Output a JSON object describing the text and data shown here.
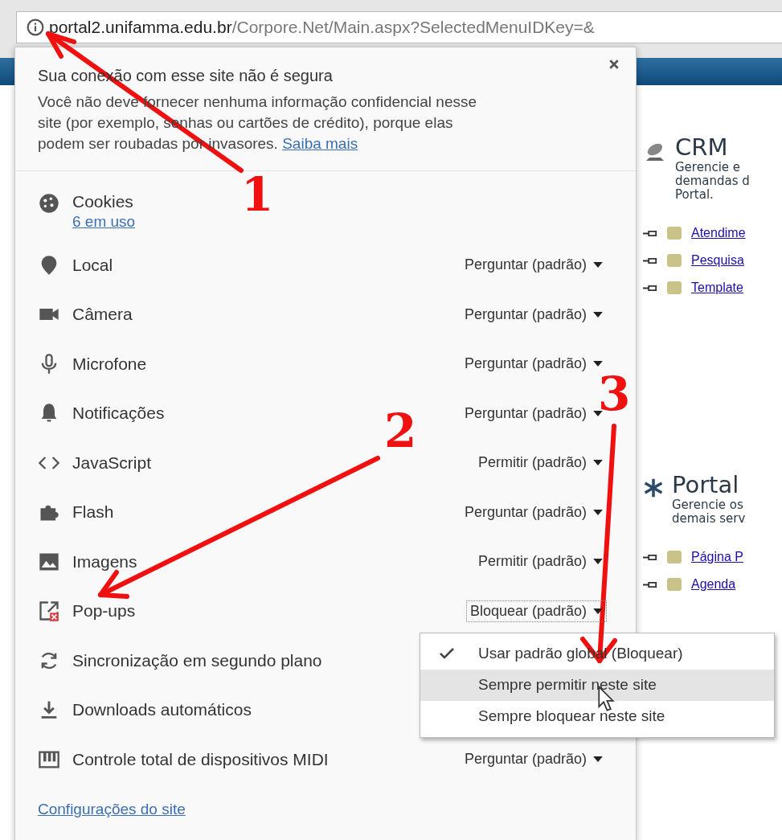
{
  "address_bar": {
    "host": "portal2.unifamma.edu.br",
    "path": "/Corpore.Net/Main.aspx?SelectedMenuIDKey=&"
  },
  "background_page": {
    "sections": [
      {
        "title": "CRM",
        "description": [
          "Gerencie e",
          "demandas d",
          "Portal."
        ],
        "links": [
          "Atendime",
          "Pesquisa",
          "Template"
        ]
      },
      {
        "title": "Portal",
        "description": [
          "Gerencie os",
          "demais serv"
        ],
        "links": [
          "Página P",
          "Agenda"
        ]
      }
    ]
  },
  "site_info_popup": {
    "title": "Sua conexão com esse site não é segura",
    "message": "Você não deve fornecer nenhuma informação confidencial nesse site (por exemplo, senhas ou cartões de crédito), porque elas podem ser roubadas por invasores.",
    "learn_more": "Saiba mais",
    "permissions": [
      {
        "label": "Cookies",
        "sublabel": "6 em uso"
      },
      {
        "label": "Local",
        "value": "Perguntar (padrão)"
      },
      {
        "label": "Câmera",
        "value": "Perguntar (padrão)"
      },
      {
        "label": "Microfone",
        "value": "Perguntar (padrão)"
      },
      {
        "label": "Notificações",
        "value": "Perguntar (padrão)"
      },
      {
        "label": "JavaScript",
        "value": "Permitir (padrão)"
      },
      {
        "label": "Flash",
        "value": "Perguntar (padrão)"
      },
      {
        "label": "Imagens",
        "value": "Permitir (padrão)"
      },
      {
        "label": "Pop-ups",
        "value": "Bloquear (padrão)",
        "expanded": true,
        "options": [
          {
            "label": "Usar padrão global (Bloquear)",
            "checked": true,
            "selected": false
          },
          {
            "label": "Sempre permitir neste site",
            "checked": false,
            "selected": true
          },
          {
            "label": "Sempre bloquear neste site",
            "checked": false,
            "selected": false
          }
        ]
      },
      {
        "label": "Sincronização em segundo plano"
      },
      {
        "label": "Downloads automáticos"
      },
      {
        "label": "Controle total de dispositivos MIDI",
        "value": "Perguntar (padrão)"
      }
    ],
    "site_settings_link": "Configurações do site"
  },
  "annotations": [
    {
      "label": "1"
    },
    {
      "label": "2"
    },
    {
      "label": "3"
    }
  ]
}
